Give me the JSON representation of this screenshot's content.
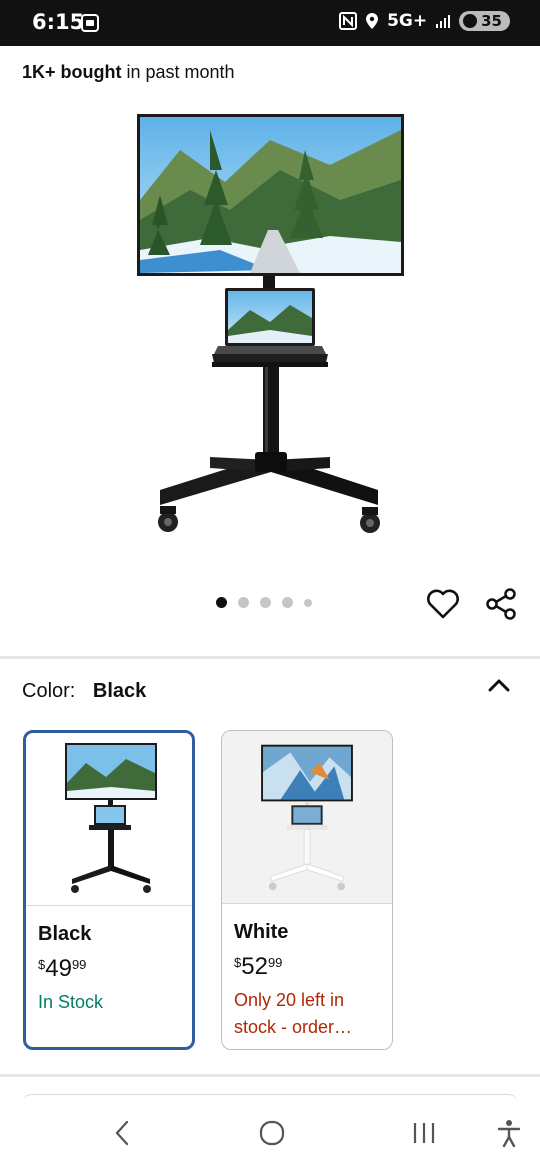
{
  "status": {
    "time": "6:15",
    "network": "5G+",
    "battery": "35"
  },
  "product": {
    "bought_bold": "1K+ bought",
    "bought_rest": " in past month"
  },
  "gallery": {
    "dots_count": 5,
    "active_index": 0
  },
  "color": {
    "label": "Color:",
    "selected": "Black"
  },
  "swatches": [
    {
      "name": "Black",
      "price_symbol": "$",
      "price_whole": "49",
      "price_fraction": "99",
      "stock": "In Stock",
      "stock_color": "#067d62",
      "selected": true
    },
    {
      "name": "White",
      "price_symbol": "$",
      "price_whole": "52",
      "price_fraction": "99",
      "stock": "Only 20 left in stock - order…",
      "stock_color": "#b12704",
      "selected": false
    }
  ],
  "icons": [
    "camera-icon",
    "nfc-icon",
    "location-icon",
    "signal-icon",
    "battery-icon",
    "heart-icon",
    "share-icon",
    "chevron-up-icon",
    "back-icon",
    "home-icon",
    "recent-apps-icon",
    "accessibility-icon"
  ]
}
